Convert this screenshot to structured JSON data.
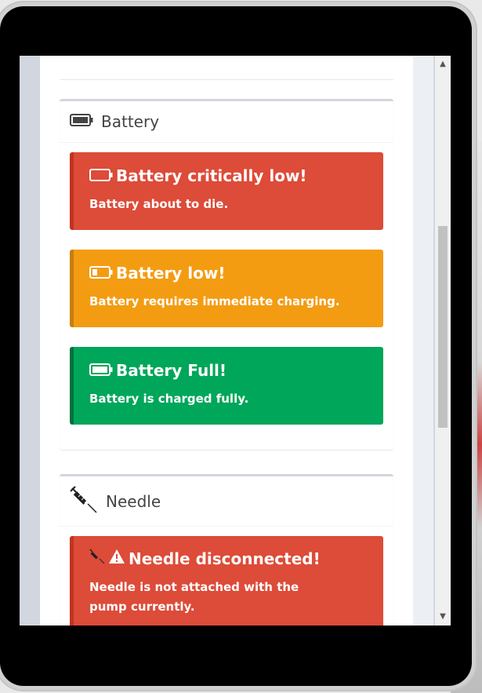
{
  "battery_panel": {
    "title": "Battery",
    "icon": "battery-full-icon",
    "alerts": [
      {
        "title": "Battery critically low!",
        "message": "Battery about to die.",
        "icon": "battery-empty-icon",
        "color": "#dd4b39"
      },
      {
        "title": "Battery low!",
        "message": "Battery requires immediate charging.",
        "icon": "battery-quarter-icon",
        "color": "#f39c12"
      },
      {
        "title": "Battery Full!",
        "message": "Battery is charged fully.",
        "icon": "battery-full-icon",
        "color": "#00a65a"
      }
    ]
  },
  "needle_panel": {
    "title": "Needle",
    "icon": "syringe-icon",
    "alerts": [
      {
        "title": "Needle disconnected!",
        "message": "Needle is not attached with the pump currently.",
        "icon": "warning-icon",
        "color": "#dd4b39"
      }
    ]
  },
  "scrollbar": {
    "up_arrow": "▲",
    "down_arrow": "▼"
  }
}
